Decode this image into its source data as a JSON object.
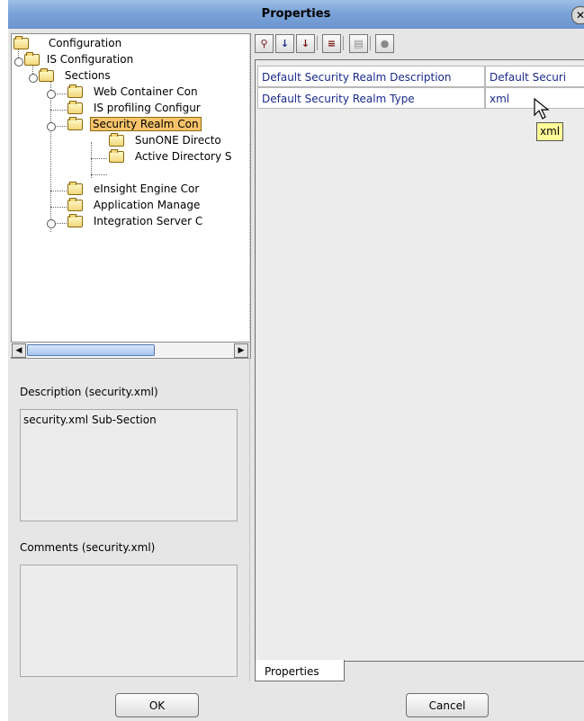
{
  "window": {
    "title": "Properties"
  },
  "tree": {
    "items": [
      {
        "label": "Configuration"
      },
      {
        "label": "IS Configuration"
      },
      {
        "label": "Sections"
      },
      {
        "label": "Web Container Con"
      },
      {
        "label": "IS profiling Configur"
      },
      {
        "label": "Security Realm Con"
      },
      {
        "label": "SunONE Directo"
      },
      {
        "label": "Active Directory S"
      },
      {
        "label": "eInsight Engine Cor"
      },
      {
        "label": "Application Manage"
      },
      {
        "label": "Integration Server C"
      }
    ]
  },
  "description": {
    "label": "Description (security.xml)",
    "text": "security.xml Sub-Section"
  },
  "comments": {
    "label": "Comments (security.xml)",
    "text": ""
  },
  "properties": {
    "rows": [
      {
        "name": "Default Security Realm Description",
        "value": "Default Securi"
      },
      {
        "name": "Default Security Realm Type",
        "value": "xml"
      }
    ],
    "tooltip": "xml",
    "tab_label": "Properties"
  },
  "buttons": {
    "ok": "OK",
    "cancel": "Cancel"
  },
  "toolbar": {
    "icons": [
      "pin-icon",
      "sort-az-icon",
      "categorize-icon",
      "filter-icon",
      "doc-icon",
      "help-icon"
    ]
  },
  "colors": {
    "titlebar": "#7aa3d7",
    "selection": "#f7c46a",
    "tooltip": "#ffff99"
  }
}
